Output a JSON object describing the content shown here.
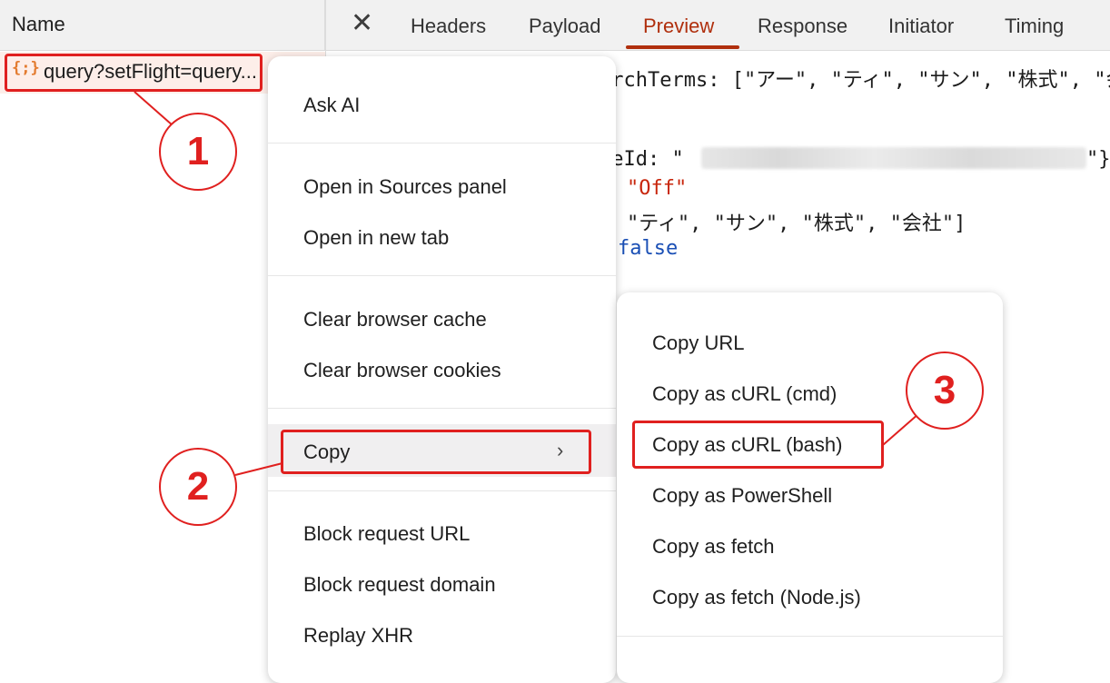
{
  "network_list": {
    "column_header": "Name",
    "request": {
      "icon": "json-braces-icon",
      "label": "query?setFlight=query..."
    }
  },
  "details_tabs": {
    "close_glyph": "✕",
    "tabs": [
      "Headers",
      "Payload",
      "Preview",
      "Response",
      "Initiator",
      "Timing"
    ],
    "active_tab": "Preview"
  },
  "preview": {
    "line1": "archTerms: [\"アー\", \"ティ\", \"サン\", \"株式\", \"会",
    "line2_prefix": "ceId: \"",
    "line2_suffix": "\"}",
    "line3": "\"Off\"",
    "line4": "\"ティ\", \"サン\", \"株式\", \"会社\"]",
    "line5": "false"
  },
  "context_menu": {
    "ask_ai": "Ask AI",
    "open_sources": "Open in Sources panel",
    "open_new_tab": "Open in new tab",
    "clear_cache": "Clear browser cache",
    "clear_cookies": "Clear browser cookies",
    "copy": "Copy",
    "copy_chevron": "›",
    "block_url": "Block request URL",
    "block_domain": "Block request domain",
    "replay_xhr": "Replay XHR"
  },
  "copy_submenu": {
    "copy_url": "Copy URL",
    "copy_curl_cmd": "Copy as cURL (cmd)",
    "copy_curl_bash": "Copy as cURL (bash)",
    "copy_powershell": "Copy as PowerShell",
    "copy_fetch": "Copy as fetch",
    "copy_fetch_node": "Copy as fetch (Node.js)"
  },
  "annotations": {
    "step1": "1",
    "step2": "2",
    "step3": "3",
    "color": "#e0201f"
  }
}
